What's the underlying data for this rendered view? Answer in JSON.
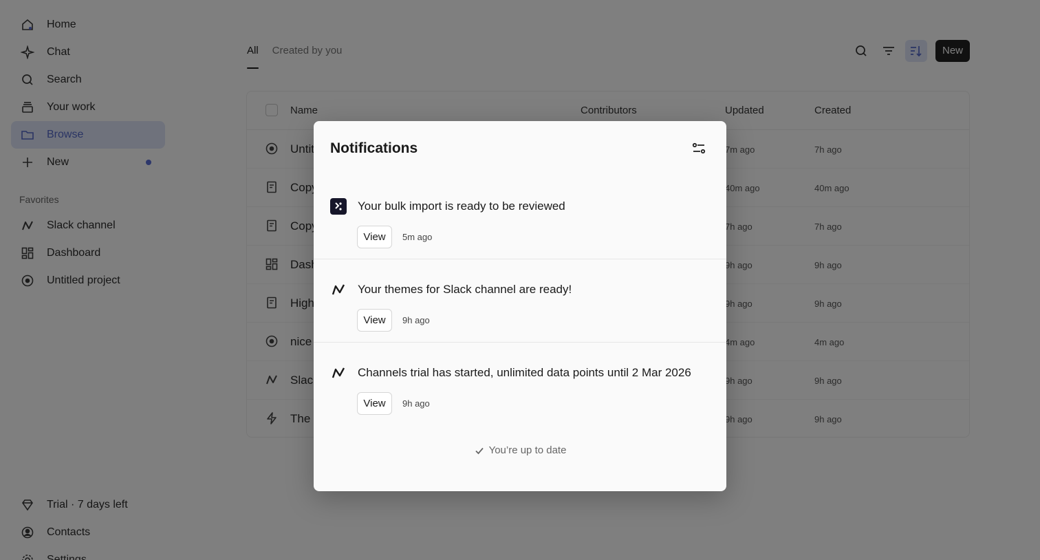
{
  "sidebar": {
    "nav": [
      {
        "label": "Home",
        "icon": "home-icon"
      },
      {
        "label": "Chat",
        "icon": "sparkle-icon"
      },
      {
        "label": "Search",
        "icon": "search-icon"
      },
      {
        "label": "Your work",
        "icon": "stack-icon"
      },
      {
        "label": "Browse",
        "icon": "folder-icon",
        "active": true
      },
      {
        "label": "New",
        "icon": "plus-icon",
        "has_dot": true
      }
    ],
    "favorites_label": "Favorites",
    "favorites": [
      {
        "label": "Slack channel",
        "icon": "trend-icon"
      },
      {
        "label": "Dashboard",
        "icon": "dashboard-icon"
      },
      {
        "label": "Untitled project",
        "icon": "compass-icon"
      }
    ],
    "bottom": [
      {
        "label": "Trial · 7 days left",
        "icon": "gem-icon"
      },
      {
        "label": "Contacts",
        "icon": "contact-icon"
      },
      {
        "label": "Settings",
        "icon": "gear-icon"
      }
    ]
  },
  "tabs": [
    {
      "label": "All",
      "active": true
    },
    {
      "label": "Created by you",
      "active": false
    }
  ],
  "toolbar": {
    "new_label": "New",
    "icons": [
      "search-icon",
      "filter-icon",
      "sort-icon"
    ]
  },
  "table": {
    "headers": {
      "name": "Name",
      "contributors": "Contributors",
      "updated": "Updated",
      "created": "Created"
    },
    "rows": [
      {
        "name": "Untit",
        "icon": "compass-icon",
        "updated": "7m ago",
        "created": "7h ago"
      },
      {
        "name": "Copy",
        "icon": "document-icon",
        "updated": "40m ago",
        "created": "40m ago"
      },
      {
        "name": "Copy",
        "icon": "document-icon",
        "updated": "7h ago",
        "created": "7h ago"
      },
      {
        "name": "Dash",
        "icon": "dashboard-icon",
        "updated": "9h ago",
        "created": "9h ago"
      },
      {
        "name": "High",
        "icon": "document-icon",
        "updated": "9h ago",
        "created": "9h ago"
      },
      {
        "name": "nice",
        "icon": "compass-icon",
        "updated": "4m ago",
        "created": "4m ago"
      },
      {
        "name": "Slac",
        "icon": "trend-icon",
        "updated": "9h ago",
        "created": "9h ago"
      },
      {
        "name": "The",
        "icon": "bolt-icon",
        "updated": "9h ago",
        "created": "9h ago"
      }
    ]
  },
  "modal": {
    "title": "Notifications",
    "notifications": [
      {
        "text": "Your bulk import is ready to be reviewed",
        "button": "View",
        "time": "5m ago",
        "icon": "app-logo-icon"
      },
      {
        "text": "Your themes for Slack channel are ready!",
        "button": "View",
        "time": "9h ago",
        "icon": "trend-icon"
      },
      {
        "text": "Channels trial has started, unlimited data points until 2 Mar 2026",
        "button": "View",
        "time": "9h ago",
        "icon": "trend-icon"
      }
    ],
    "footer": "You’re up to date"
  }
}
